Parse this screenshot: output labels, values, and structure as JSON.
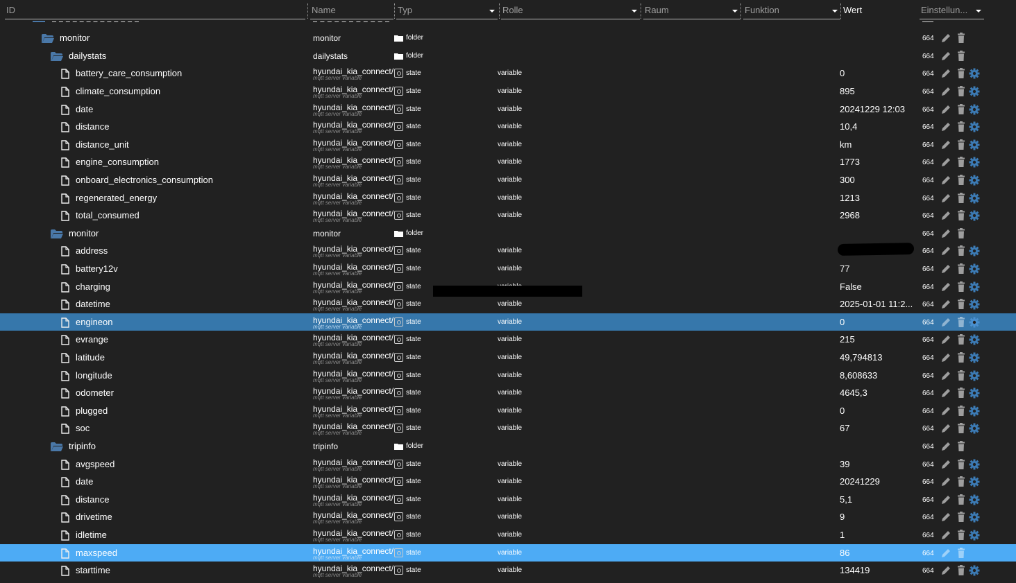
{
  "header": {
    "columns": [
      {
        "key": "id",
        "label": "ID",
        "dropdown": false
      },
      {
        "key": "name",
        "label": "Name",
        "dropdown": false
      },
      {
        "key": "type",
        "label": "Typ",
        "dropdown": true
      },
      {
        "key": "role",
        "label": "Rolle",
        "dropdown": true
      },
      {
        "key": "room",
        "label": "Raum",
        "dropdown": true
      },
      {
        "key": "function",
        "label": "Funktion",
        "dropdown": true
      },
      {
        "key": "value",
        "label": "Wert",
        "dropdown": false
      },
      {
        "key": "settings",
        "label": "Einstellun...",
        "dropdown": true
      }
    ]
  },
  "colors": {
    "background": "#212121",
    "folder": "#4a78a8",
    "selected_primary": "#3677ab",
    "selected_secondary": "#4dabf5",
    "gear": "#3c7bb5",
    "icon_gray": "#9e9e9e"
  },
  "rows": [
    {
      "kind": "folder",
      "level": 1,
      "id": "monitor",
      "name": "monitor",
      "type": "folder",
      "role": "",
      "value": "",
      "acl": "664"
    },
    {
      "kind": "folder",
      "level": 2,
      "id": "dailystats",
      "name": "dailystats",
      "type": "folder",
      "role": "",
      "value": "",
      "acl": "664"
    },
    {
      "kind": "state",
      "level": 3,
      "id": "battery_care_consumption",
      "name": "hyundai_kia_connect/KI",
      "desc": "mqtt server variable",
      "type": "state",
      "role": "variable",
      "value": "0",
      "acl": "664"
    },
    {
      "kind": "state",
      "level": 3,
      "id": "climate_consumption",
      "name": "hyundai_kia_connect/KI",
      "desc": "mqtt server variable",
      "type": "state",
      "role": "variable",
      "value": "895",
      "acl": "664"
    },
    {
      "kind": "state",
      "level": 3,
      "id": "date",
      "name": "hyundai_kia_connect/KI",
      "desc": "mqtt server variable",
      "type": "state",
      "role": "variable",
      "value": "20241229 12:03",
      "acl": "664"
    },
    {
      "kind": "state",
      "level": 3,
      "id": "distance",
      "name": "hyundai_kia_connect/KI",
      "desc": "mqtt server variable",
      "type": "state",
      "role": "variable",
      "value": "10,4",
      "acl": "664"
    },
    {
      "kind": "state",
      "level": 3,
      "id": "distance_unit",
      "name": "hyundai_kia_connect/KI",
      "desc": "mqtt server variable",
      "type": "state",
      "role": "variable",
      "value": "km",
      "acl": "664"
    },
    {
      "kind": "state",
      "level": 3,
      "id": "engine_consumption",
      "name": "hyundai_kia_connect/KI",
      "desc": "mqtt server variable",
      "type": "state",
      "role": "variable",
      "value": "1773",
      "acl": "664"
    },
    {
      "kind": "state",
      "level": 3,
      "id": "onboard_electronics_consumption",
      "name": "hyundai_kia_connect/KI",
      "desc": "mqtt server variable",
      "type": "state",
      "role": "variable",
      "value": "300",
      "acl": "664"
    },
    {
      "kind": "state",
      "level": 3,
      "id": "regenerated_energy",
      "name": "hyundai_kia_connect/KI",
      "desc": "mqtt server variable",
      "type": "state",
      "role": "variable",
      "value": "1213",
      "acl": "664"
    },
    {
      "kind": "state",
      "level": 3,
      "id": "total_consumed",
      "name": "hyundai_kia_connect/KI",
      "desc": "mqtt server variable",
      "type": "state",
      "role": "variable",
      "value": "2968",
      "acl": "664"
    },
    {
      "kind": "folder",
      "level": 2,
      "id": "monitor",
      "name": "monitor",
      "type": "folder",
      "role": "",
      "value": "",
      "acl": "664"
    },
    {
      "kind": "state",
      "level": 3,
      "id": "address",
      "name": "hyundai_kia_connect/KI",
      "desc": "mqtt server variable",
      "type": "state",
      "role": "variable",
      "value": "",
      "acl": "664"
    },
    {
      "kind": "state",
      "level": 3,
      "id": "battery12v",
      "name": "hyundai_kia_connect/KI",
      "desc": "mqtt server variable",
      "type": "state",
      "role": "variable",
      "value": "77",
      "acl": "664"
    },
    {
      "kind": "state",
      "level": 3,
      "id": "charging",
      "name": "hyundai_kia_connect/KI",
      "desc": "mqtt server variable",
      "type": "state",
      "role": "variable",
      "value": "False",
      "acl": "664"
    },
    {
      "kind": "state",
      "level": 3,
      "id": "datetime",
      "name": "hyundai_kia_connect/KI",
      "desc": "mqtt server variable",
      "type": "state",
      "role": "variable",
      "value": "2025-01-01 11:2...",
      "acl": "664"
    },
    {
      "kind": "state",
      "level": 3,
      "id": "engineon",
      "name": "hyundai_kia_connect/KI",
      "desc": "mqtt server variable",
      "type": "state",
      "role": "variable",
      "value": "0",
      "acl": "664",
      "selected": "primary"
    },
    {
      "kind": "state",
      "level": 3,
      "id": "evrange",
      "name": "hyundai_kia_connect/KI",
      "desc": "mqtt server variable",
      "type": "state",
      "role": "variable",
      "value": "215",
      "acl": "664"
    },
    {
      "kind": "state",
      "level": 3,
      "id": "latitude",
      "name": "hyundai_kia_connect/KI",
      "desc": "mqtt server variable",
      "type": "state",
      "role": "variable",
      "value": "49,794813",
      "acl": "664"
    },
    {
      "kind": "state",
      "level": 3,
      "id": "longitude",
      "name": "hyundai_kia_connect/KI",
      "desc": "mqtt server variable",
      "type": "state",
      "role": "variable",
      "value": "8,608633",
      "acl": "664"
    },
    {
      "kind": "state",
      "level": 3,
      "id": "odometer",
      "name": "hyundai_kia_connect/KI",
      "desc": "mqtt server variable",
      "type": "state",
      "role": "variable",
      "value": "4645,3",
      "acl": "664"
    },
    {
      "kind": "state",
      "level": 3,
      "id": "plugged",
      "name": "hyundai_kia_connect/KI",
      "desc": "mqtt server variable",
      "type": "state",
      "role": "variable",
      "value": "0",
      "acl": "664"
    },
    {
      "kind": "state",
      "level": 3,
      "id": "soc",
      "name": "hyundai_kia_connect/KI",
      "desc": "mqtt server variable",
      "type": "state",
      "role": "variable",
      "value": "67",
      "acl": "664"
    },
    {
      "kind": "folder",
      "level": 2,
      "id": "tripinfo",
      "name": "tripinfo",
      "type": "folder",
      "role": "",
      "value": "",
      "acl": "664"
    },
    {
      "kind": "state",
      "level": 3,
      "id": "avgspeed",
      "name": "hyundai_kia_connect/KI",
      "desc": "mqtt server variable",
      "type": "state",
      "role": "variable",
      "value": "39",
      "acl": "664"
    },
    {
      "kind": "state",
      "level": 3,
      "id": "date",
      "name": "hyundai_kia_connect/KI",
      "desc": "mqtt server variable",
      "type": "state",
      "role": "variable",
      "value": "20241229",
      "acl": "664"
    },
    {
      "kind": "state",
      "level": 3,
      "id": "distance",
      "name": "hyundai_kia_connect/KI",
      "desc": "mqtt server variable",
      "type": "state",
      "role": "variable",
      "value": "5,1",
      "acl": "664"
    },
    {
      "kind": "state",
      "level": 3,
      "id": "drivetime",
      "name": "hyundai_kia_connect/KI",
      "desc": "mqtt server variable",
      "type": "state",
      "role": "variable",
      "value": "9",
      "acl": "664"
    },
    {
      "kind": "state",
      "level": 3,
      "id": "idletime",
      "name": "hyundai_kia_connect/KI",
      "desc": "mqtt server variable",
      "type": "state",
      "role": "variable",
      "value": "1",
      "acl": "664"
    },
    {
      "kind": "state",
      "level": 3,
      "id": "maxspeed",
      "name": "hyundai_kia_connect/KI",
      "desc": "mqtt server variable",
      "type": "state",
      "role": "variable",
      "value": "86",
      "acl": "664",
      "selected": "secondary"
    },
    {
      "kind": "state",
      "level": 3,
      "id": "starttime",
      "name": "hyundai_kia_connect/KI",
      "desc": "mqtt server variable",
      "type": "state",
      "role": "variable",
      "value": "134419",
      "acl": "664"
    }
  ]
}
